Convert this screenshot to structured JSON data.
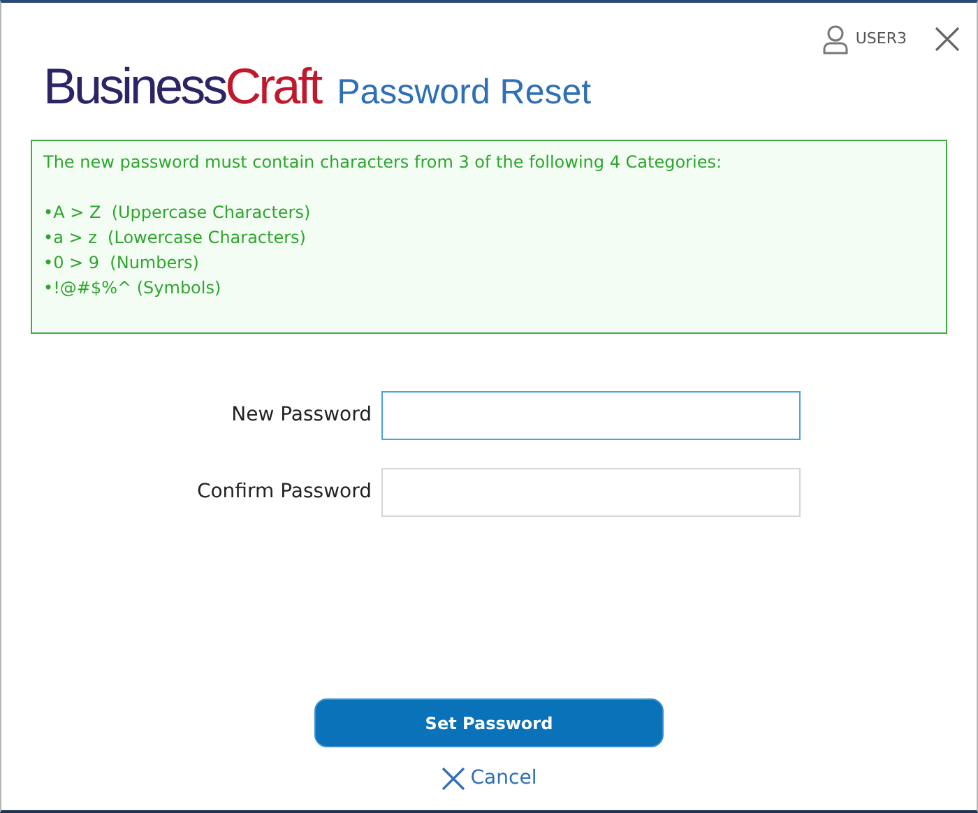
{
  "user": {
    "name": "USER3"
  },
  "logo": {
    "part_1": "Business",
    "part_2": "Craft"
  },
  "title": "Password Reset",
  "rules": {
    "intro": "The new password must contain characters from 3 of the following 4 Categories:",
    "items": [
      "•A > Z  (Uppercase Characters)",
      "•a > z  (Lowercase Characters)",
      "•0 > 9  (Numbers)",
      "•!@#$%^ (Symbols)"
    ]
  },
  "fields": [
    {
      "label": "New Password",
      "focused": true
    },
    {
      "label": "Confirm Password",
      "focused": false
    }
  ],
  "submit": "Set Password",
  "cancel": "Cancel"
}
